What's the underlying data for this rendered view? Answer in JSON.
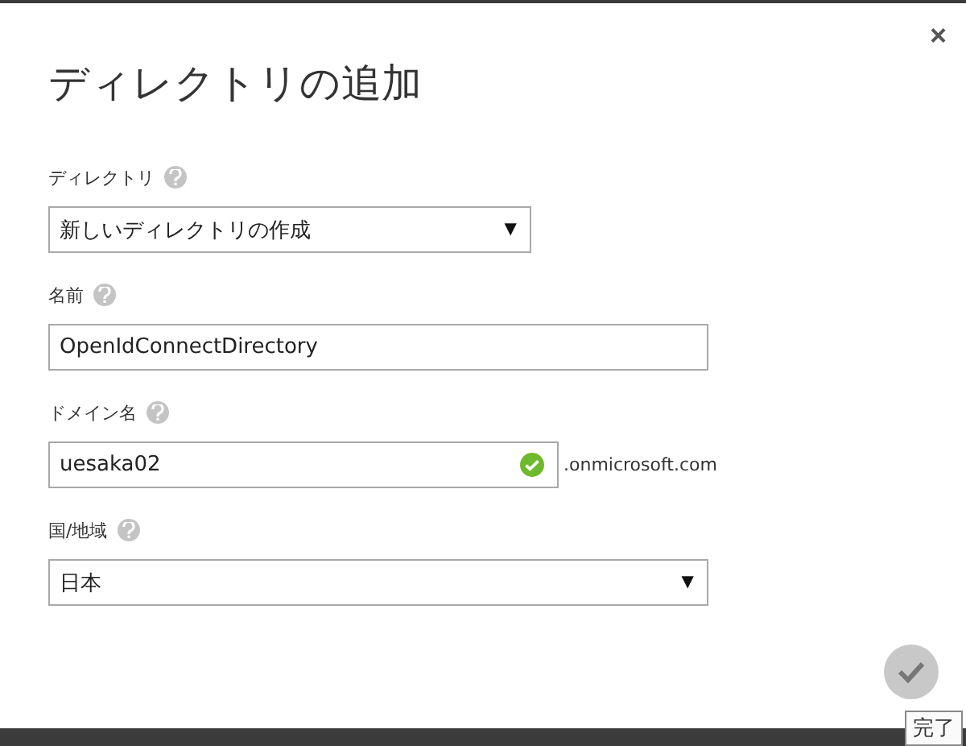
{
  "dialog": {
    "title": "ディレクトリの追加",
    "close": "×"
  },
  "fields": [
    {
      "kind": "select",
      "label": "ディレクトリ",
      "value": "新しいディレクトリの作成",
      "caret": "▼",
      "wide": false
    },
    {
      "kind": "text",
      "label": "名前",
      "value": "OpenIdConnectDirectory",
      "wide": true
    },
    {
      "kind": "text",
      "label": "ドメイン名",
      "value": "uesaka02",
      "valid": true,
      "suffix": ".onmicrosoft.com",
      "wide": false
    },
    {
      "kind": "select",
      "label": "国/地域",
      "value": "日本",
      "caret": "▼",
      "wide": true
    }
  ],
  "done": {
    "tooltip": "完了",
    "disabled": true
  }
}
